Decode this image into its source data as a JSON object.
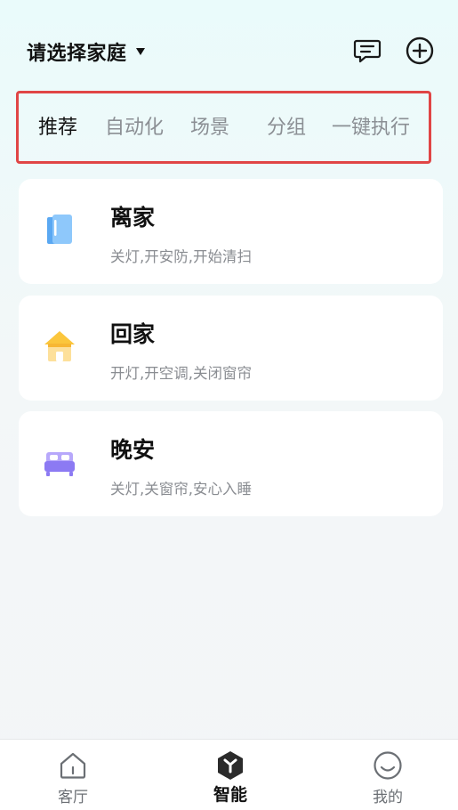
{
  "header": {
    "family_select_label": "请选择家庭",
    "icons": [
      "message-icon",
      "add-circle-icon"
    ]
  },
  "tabs": [
    {
      "label": "推荐",
      "active": true
    },
    {
      "label": "自动化",
      "active": false
    },
    {
      "label": "场景",
      "active": false
    },
    {
      "label": "分组",
      "active": false
    },
    {
      "label": "一键执行",
      "active": false
    }
  ],
  "scenes": [
    {
      "title": "离家",
      "description": "关灯,开安防,开始清扫",
      "icon": "door-icon"
    },
    {
      "title": "回家",
      "description": "开灯,开空调,关闭窗帘",
      "icon": "house-icon"
    },
    {
      "title": "晚安",
      "description": "关灯,关窗帘,安心入睡",
      "icon": "bed-icon"
    }
  ],
  "bottom_nav": [
    {
      "label": "客厅",
      "icon": "home-outline-icon",
      "active": false
    },
    {
      "label": "智能",
      "icon": "smart-hex-icon",
      "active": true
    },
    {
      "label": "我的",
      "icon": "smiley-face-icon",
      "active": false
    }
  ],
  "colors": {
    "highlight_border": "#e04545",
    "door_icon": "#5aa8f2",
    "house_icon": "#f7c254",
    "bed_icon": "#8c7af3"
  }
}
